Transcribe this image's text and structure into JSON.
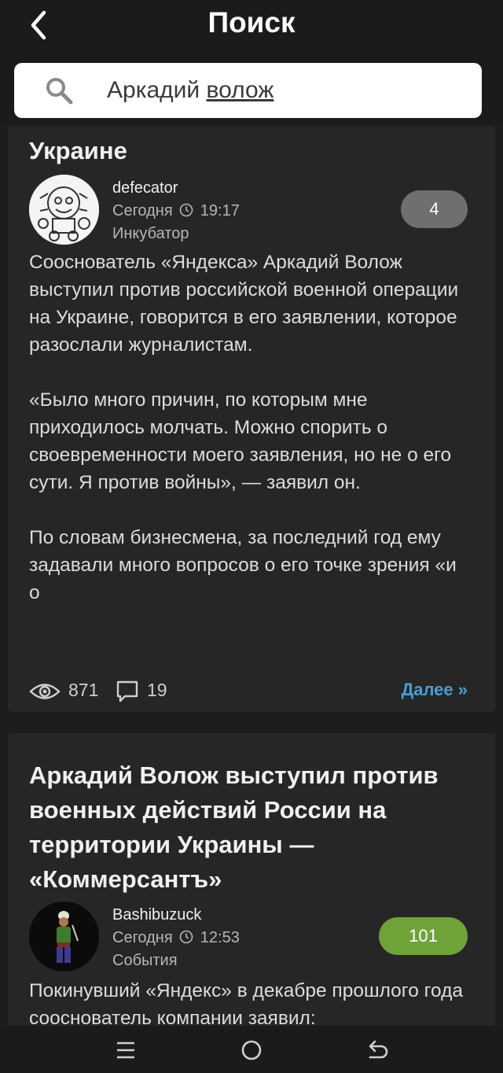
{
  "header": {
    "title": "Поиск"
  },
  "search": {
    "query_plain": "Аркадий ",
    "query_underlined": "волож"
  },
  "posts": [
    {
      "title": "Украине",
      "author": "defecator",
      "date": "Сегодня",
      "time": "19:17",
      "community": "Инкубатор",
      "rating": "4",
      "paragraphs": [
        "Сооснователь «Яндекса» Аркадий Волож выступил против российской военной операции на Украине, говорится в его заявлении, которое разослали журналистам.",
        "«Было много причин, по которым мне приходилось молчать. Можно спорить о своевременности моего заявления, но не о его сути. Я против войны», — заявил он.",
        "По словам бизнесмена, за последний год ему задавали много вопросов о его точке зрения «и о"
      ],
      "views": "871",
      "comments": "19",
      "more_label": "Далее »"
    },
    {
      "title": "Аркадий Волож выступил против военных действий России на территории Украины — «Коммерсантъ»",
      "author": "Bashibuzuck",
      "date": "Сегодня",
      "time": "12:53",
      "community": "События",
      "rating": "101",
      "paragraphs": [
        "Покинувший «Яндекс» в декабре прошлого года сооснователь компании заявил:"
      ]
    }
  ],
  "icons": {
    "back": "chevron-left-icon",
    "search": "search-icon",
    "clock": "clock-icon",
    "views": "eye-icon",
    "comments": "comment-icon",
    "nav_menu": "menu-icon",
    "nav_home": "home-icon",
    "nav_back": "back-arrow-icon"
  },
  "colors": {
    "background": "#1d1d1d",
    "card": "#262626",
    "link": "#4a9ed8",
    "rating_neutral": "#6f6f6f",
    "rating_positive": "#6fa33a"
  }
}
